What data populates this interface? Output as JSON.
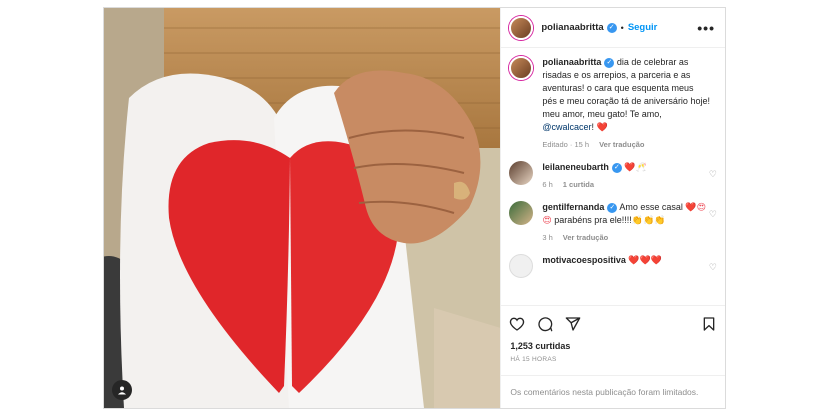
{
  "post": {
    "username": "polianaabritta",
    "verified_mark": "✓",
    "dot": "•",
    "follow_label": "Seguir",
    "more_label": "•••",
    "caption": {
      "username": "polianaabritta",
      "text_before": "dia de celebrar as risadas e os arrepios, a parceria e as aventuras! o cara que esquenta meus pés e meu coração tá de aniversário hoje! meu amor, meu gato! Te amo, ",
      "mention": "@cwalcacer",
      "text_after": "! ",
      "emoji": "❤️",
      "edited": "Editado · 15 h",
      "translate": "Ver tradução"
    },
    "comments": [
      {
        "username": "leilaneneubarth",
        "text": "",
        "emoji": "❤️🥂",
        "time": "6 h",
        "likes": "1 curtida",
        "reply": ""
      },
      {
        "username": "gentilfernanda",
        "text": "Amo esse casal ",
        "emoji": "❤️😍😍",
        "text2": " parabéns pra ele!!!!👏👏👏",
        "time": "3 h",
        "likes": "",
        "reply": "Ver tradução"
      },
      {
        "username": "motivacoespositiva",
        "text": "",
        "emoji": "❤️❤️❤️",
        "time": "",
        "likes": "",
        "reply": ""
      }
    ],
    "like_count": "1,253 curtidas",
    "posted_ago": "HÁ 15 HORAS",
    "comments_limited": "Os comentários nesta publicação foram limitados.",
    "colors": {
      "accent": "#0095f6",
      "verified": "#3897f0",
      "heart": "#ed4956"
    }
  }
}
